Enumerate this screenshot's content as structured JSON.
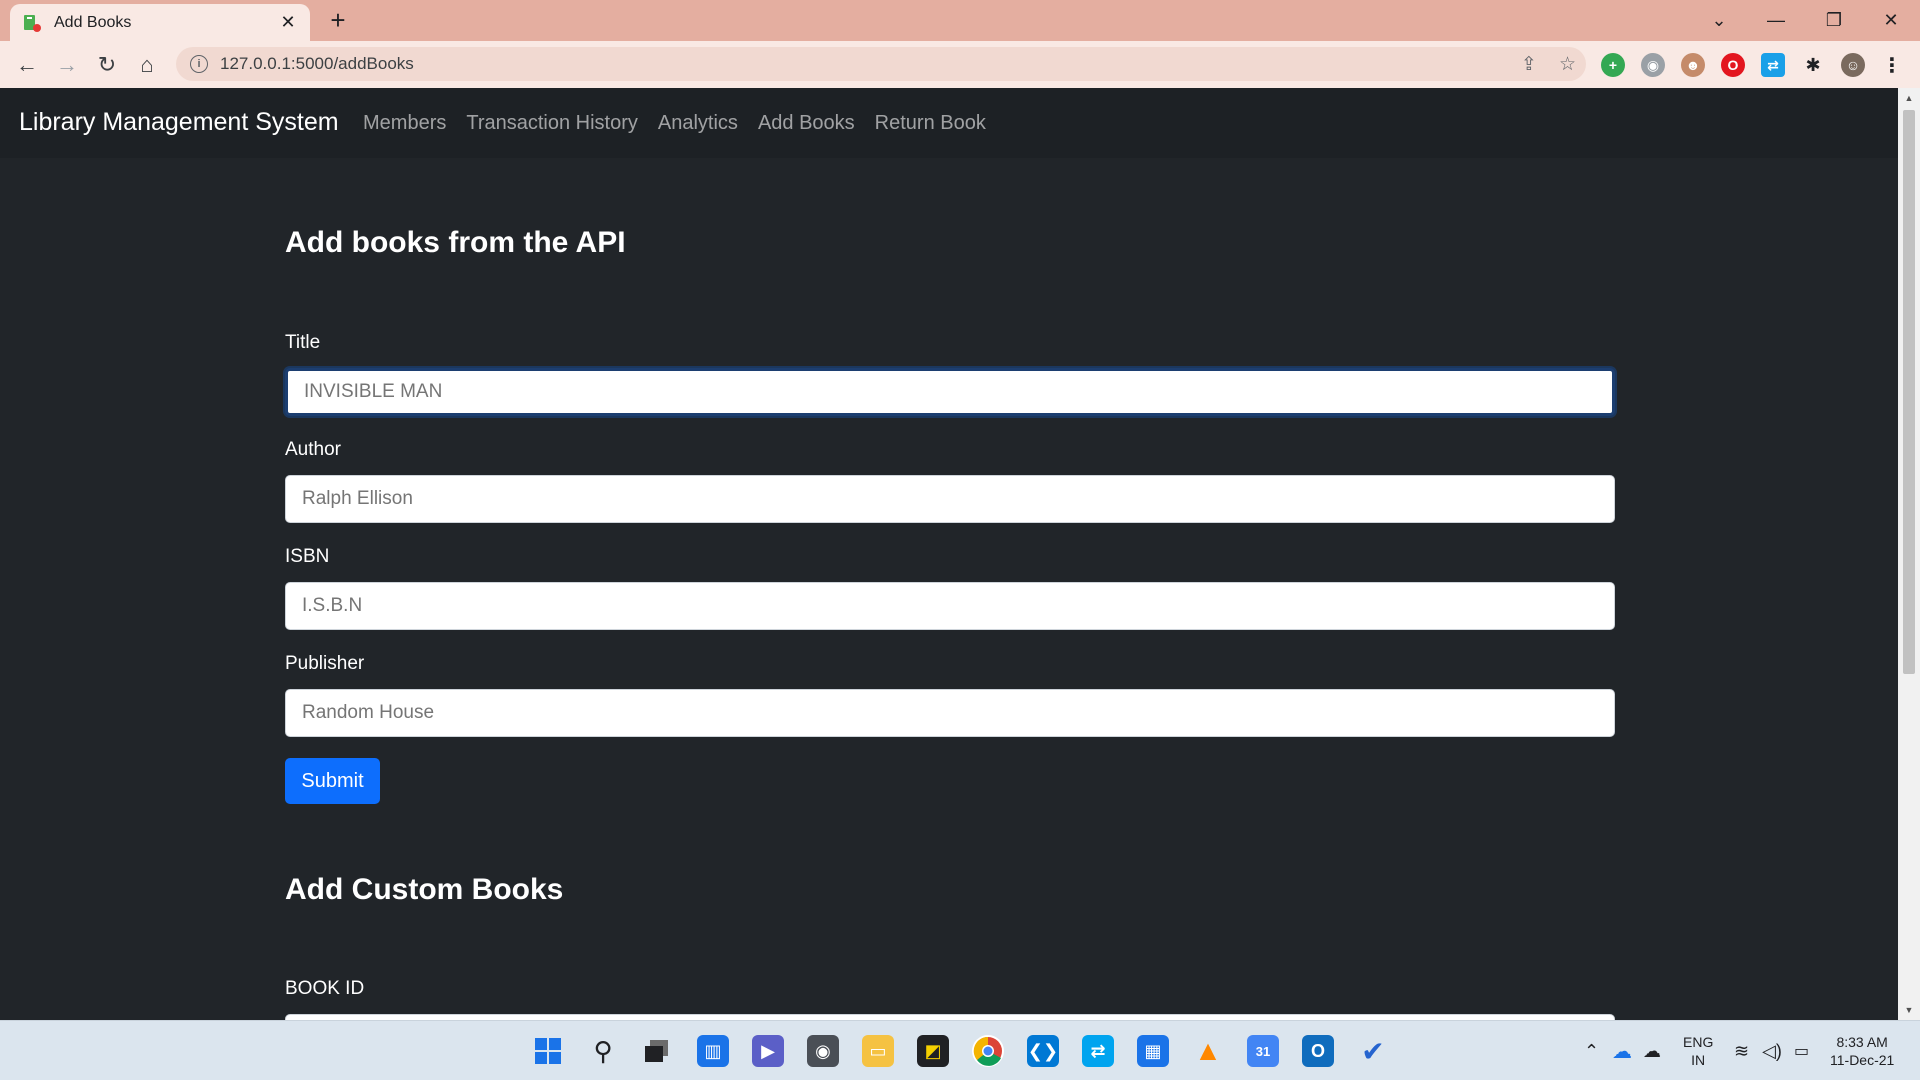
{
  "browser": {
    "tab_title": "Add Books",
    "url": "127.0.0.1:5000/addBooks"
  },
  "navbar": {
    "brand": "Library Management System",
    "links": [
      "Members",
      "Transaction History",
      "Analytics",
      "Add Books",
      "Return Book"
    ]
  },
  "api_form": {
    "heading": "Add books from the API",
    "fields": [
      {
        "label": "Title",
        "placeholder": "INVISIBLE MAN"
      },
      {
        "label": "Author",
        "placeholder": "Ralph Ellison"
      },
      {
        "label": "ISBN",
        "placeholder": "I.S.B.N"
      },
      {
        "label": "Publisher",
        "placeholder": "Random House"
      }
    ],
    "submit_label": "Submit"
  },
  "custom_form": {
    "heading": "Add Custom Books",
    "fields": [
      {
        "label": "BOOK ID"
      }
    ]
  },
  "taskbar": {
    "lang_line1": "ENG",
    "lang_line2": "IN",
    "time": "8:33 AM",
    "date": "11-Dec-21"
  },
  "colors": {
    "page_bg": "#212529",
    "navbar_bg": "#1d2125",
    "primary_button": "#0d6efd",
    "tab_strip": "#e4aea0"
  }
}
